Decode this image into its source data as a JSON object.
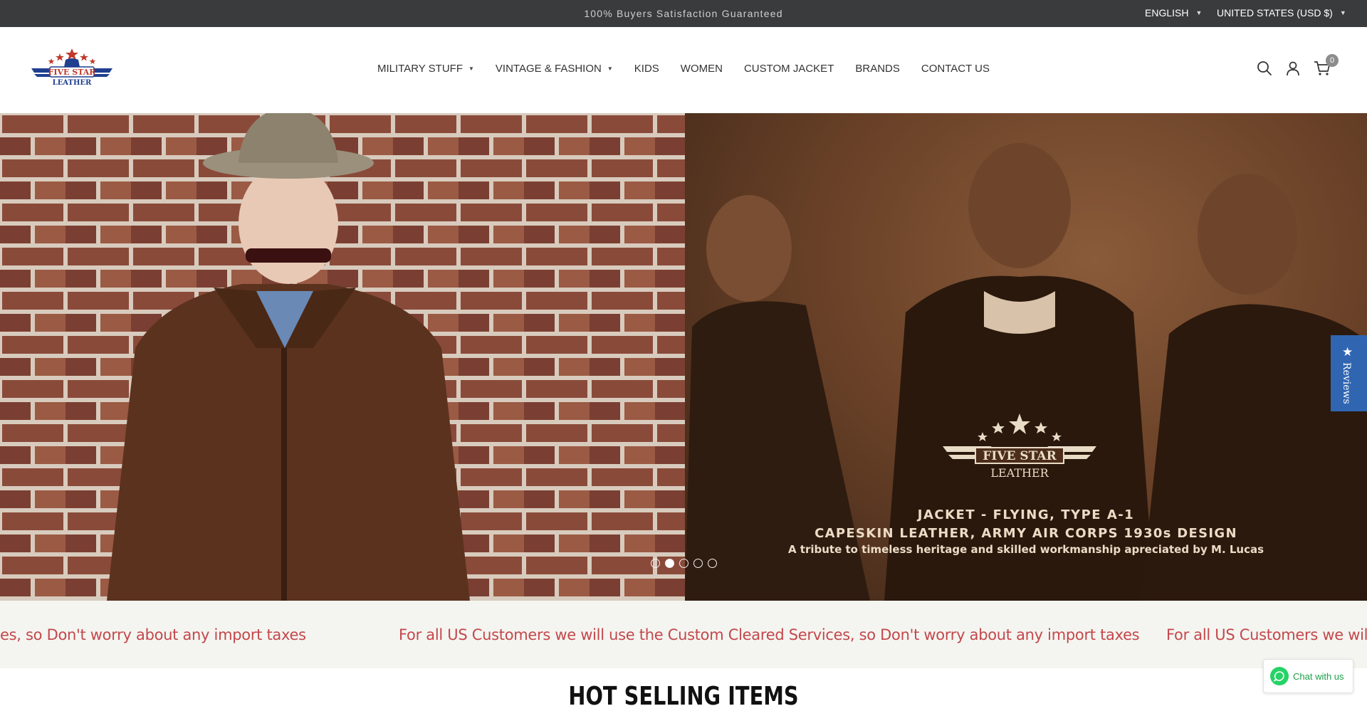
{
  "topbar": {
    "message": "100% Buyers Satisfaction Guaranteed",
    "language": "ENGLISH",
    "currency": "UNITED STATES (USD $)"
  },
  "header": {
    "logo_text": [
      "FIVE STAR",
      "LEATHER"
    ],
    "nav": [
      {
        "label": "MILITARY STUFF",
        "dropdown": true
      },
      {
        "label": "VINTAGE & FASHION",
        "dropdown": true
      },
      {
        "label": "KIDS",
        "dropdown": false
      },
      {
        "label": "WOMEN",
        "dropdown": false
      },
      {
        "label": "CUSTOM JACKET",
        "dropdown": false
      },
      {
        "label": "BRANDS",
        "dropdown": false
      },
      {
        "label": "CONTACT US",
        "dropdown": false
      }
    ],
    "icons": [
      "search-icon",
      "account-icon",
      "cart-icon"
    ],
    "cart_count": "0"
  },
  "hero": {
    "logo_text": [
      "FIVE STAR",
      "LEATHER"
    ],
    "caption_line1": "JACKET - FLYING, TYPE A-1",
    "caption_line2": "CAPESKIN LEATHER, ARMY AIR CORPS 1930s DESIGN",
    "caption_line3": "A tribute to timeless heritage and skilled workmanship apreciated by M. Lucas",
    "slide_count": 5,
    "active_slide": 2
  },
  "reviews_tab": {
    "label": "Reviews"
  },
  "marquee": {
    "text": "For all US Customers we will use the Custom Cleared Services, so Don't worry about any import taxes",
    "left_fragment": "es, so Don't worry about any import taxes",
    "right_fragment": "For all US Customers we will use"
  },
  "section": {
    "title": "HOT SELLING ITEMS"
  },
  "chat": {
    "label": "Chat with us"
  },
  "colors": {
    "topbar_bg": "#3a3b3c",
    "marquee_text": "#c4474c",
    "reviews_bg": "#3066b1",
    "whatsapp": "#25d366"
  }
}
